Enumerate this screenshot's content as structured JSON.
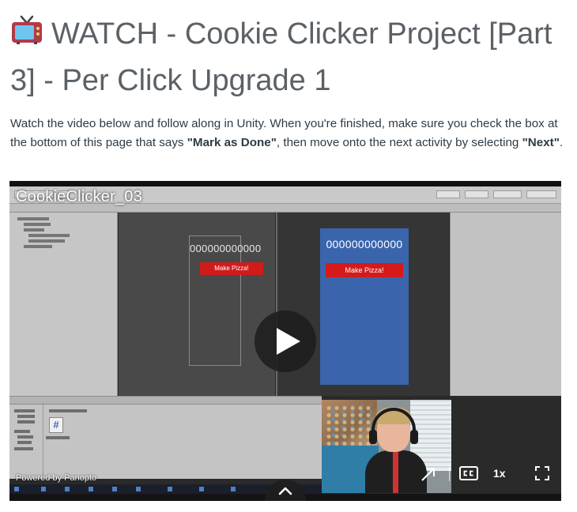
{
  "page": {
    "title": "WATCH - Cookie Clicker Project [Part 3] - Per Click Upgrade 1",
    "title_icon": "tv-icon",
    "intro": {
      "part1": "Watch the video below and follow along in Unity. When you're finished, make sure you check the box at the bottom of this page that says ",
      "bold1": "\"Mark as Done\"",
      "part2": ", then move onto the next activity by selecting ",
      "bold2": "\"Next\"",
      "part3": "."
    }
  },
  "video": {
    "title": "CookieClicker_03",
    "powered_by": "Powered by Panopto",
    "speed": "1x",
    "scene_view": {
      "counter": "000000000000",
      "button": "Make Pizza!"
    },
    "game_view": {
      "counter": "000000000000",
      "button": "Make Pizza!"
    }
  },
  "colors": {
    "title": "#5b6166",
    "body_text": "#2d3b45",
    "game_background": "#3a65ad",
    "pizza_button": "#d41a1a"
  }
}
